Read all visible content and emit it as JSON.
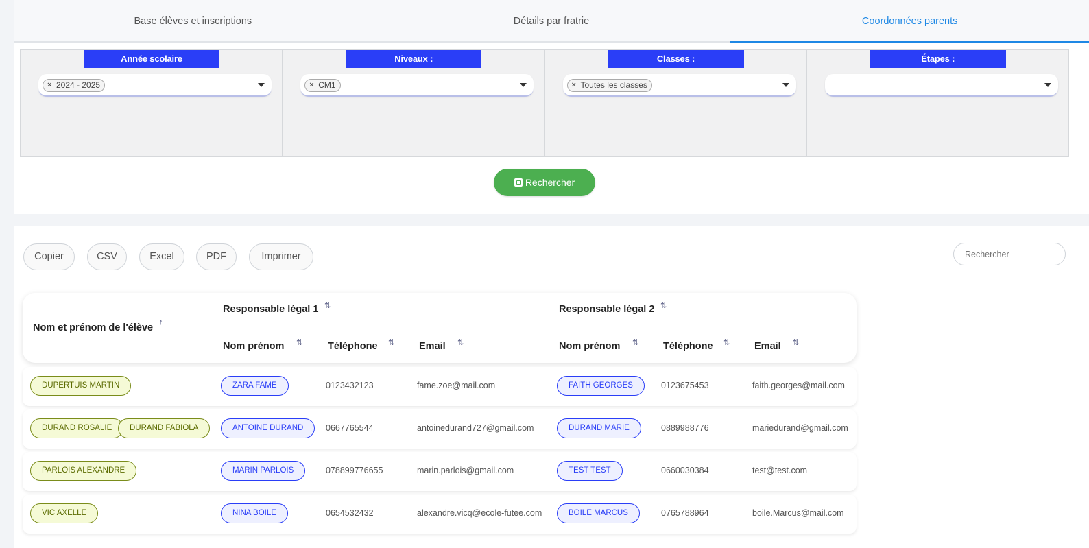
{
  "tabs": [
    {
      "label": "Base élèves et inscriptions"
    },
    {
      "label": "Détails par fratrie"
    },
    {
      "label": "Coordonnées parents"
    }
  ],
  "filters": [
    {
      "label": "Année scolaire",
      "chip": "2024 - 2025"
    },
    {
      "label": "Niveaux :",
      "chip": "CM1"
    },
    {
      "label": "Classes :",
      "chip": "Toutes les classes"
    },
    {
      "label": "Étapes :",
      "chip": ""
    }
  ],
  "search_button": {
    "label": "Rechercher"
  },
  "export_buttons": [
    "Copier",
    "CSV",
    "Excel",
    "PDF",
    "Imprimer"
  ],
  "table_search": {
    "placeholder": "Rechercher"
  },
  "table": {
    "header_student": "Nom et prénom de l'élève",
    "header_group1": "Responsable légal 1",
    "header_group2": "Responsable légal 2",
    "sub_name": "Nom prénom",
    "sub_phone": "Téléphone",
    "sub_email": "Email",
    "rows": [
      {
        "students": [
          "DUPERTUIS MARTIN"
        ],
        "r1_name": "ZARA FAME",
        "r1_phone": "0123432123",
        "r1_email": "fame.zoe@mail.com",
        "r2_name": "FAITH GEORGES",
        "r2_phone": "0123675453",
        "r2_email": "faith.georges@mail.com"
      },
      {
        "students": [
          "DURAND ROSALIE",
          "DURAND FABIOLA"
        ],
        "r1_name": "ANTOINE DURAND",
        "r1_phone": "0667765544",
        "r1_email": "antoinedurand727@gmail.com",
        "r2_name": "DURAND MARIE",
        "r2_phone": "0889988776",
        "r2_email": "mariedurand@gmail.com"
      },
      {
        "students": [
          "PARLOIS ALEXANDRE"
        ],
        "r1_name": "MARIN PARLOIS",
        "r1_phone": "078899776655",
        "r1_email": "marin.parlois@gmail.com",
        "r2_name": "TEST TEST",
        "r2_phone": "0660030384",
        "r2_email": "test@test.com"
      },
      {
        "students": [
          "VIC AXELLE"
        ],
        "r1_name": "NINA BOILE",
        "r1_phone": "0654532432",
        "r1_email": "alexandre.vicq@ecole-futee.com",
        "r2_name": "BOILE MARCUS",
        "r2_phone": "0765788964",
        "r2_email": "boile.Marcus@mail.com"
      }
    ]
  }
}
